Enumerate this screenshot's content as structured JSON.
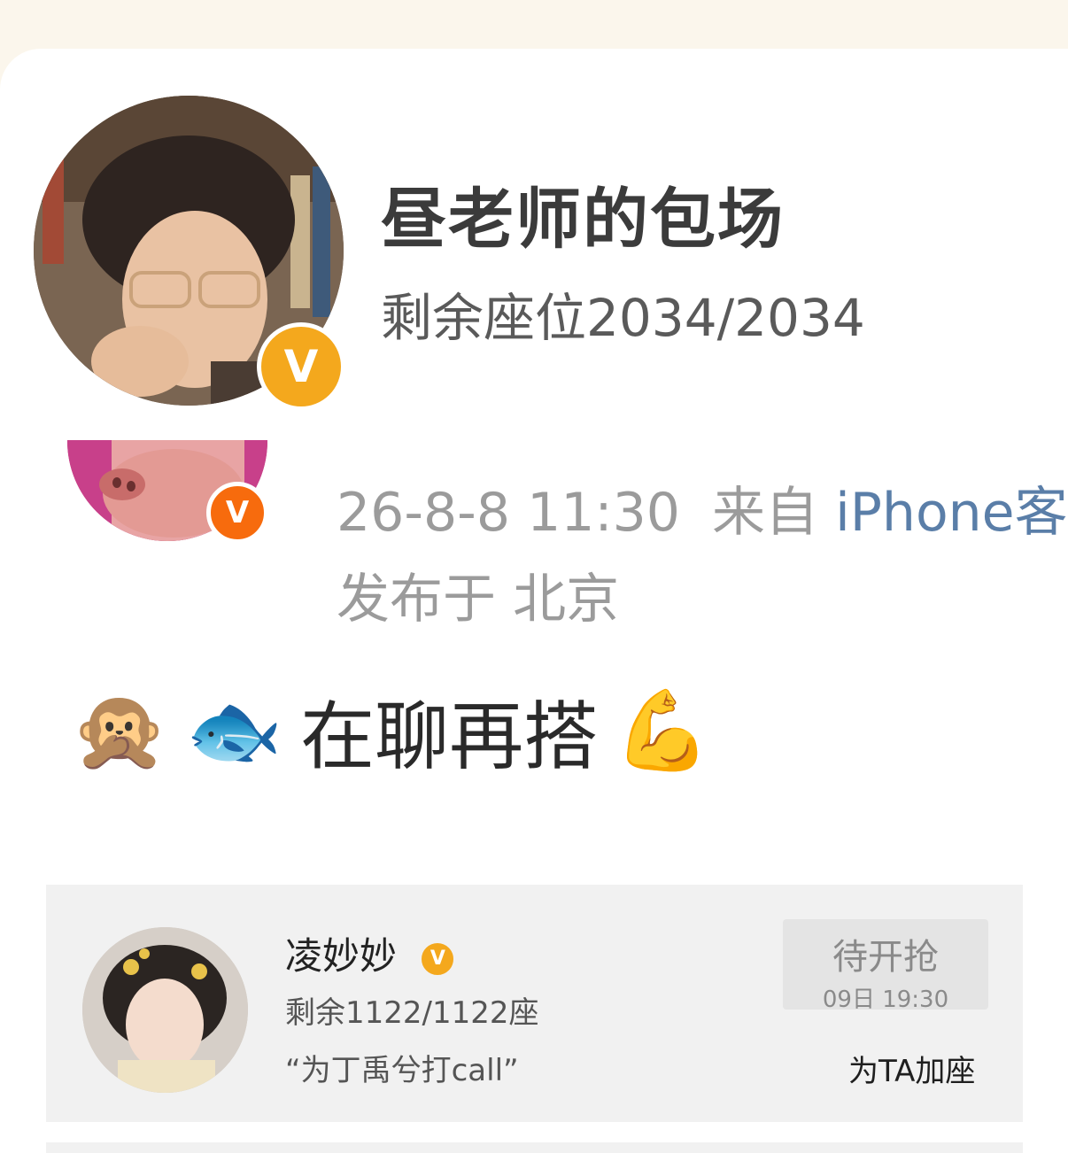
{
  "room": {
    "title": "昼老师的包场",
    "seats_label": "剩余座位2034/2034",
    "badge_glyph": "V",
    "badge_color": "#f4a81d"
  },
  "post": {
    "time": "26-8-8 11:30",
    "source_prefix": "来自",
    "client": "iPhone客",
    "location": "发布于 北京",
    "badge_glyph": "V",
    "badge_color": "#f76b0d",
    "emoji_1": "🙊",
    "emoji_2": "🐟",
    "text": "在聊再搭",
    "emoji_3": "💪"
  },
  "host": {
    "name": "凌妙妙",
    "badge_glyph": "V",
    "seats": "剩余1122/1122座",
    "slogan": "“为丁禹兮打call”",
    "button_line1": "待开抢",
    "button_line2": "09日 19:30",
    "add_seat_label": "为TA加座"
  }
}
